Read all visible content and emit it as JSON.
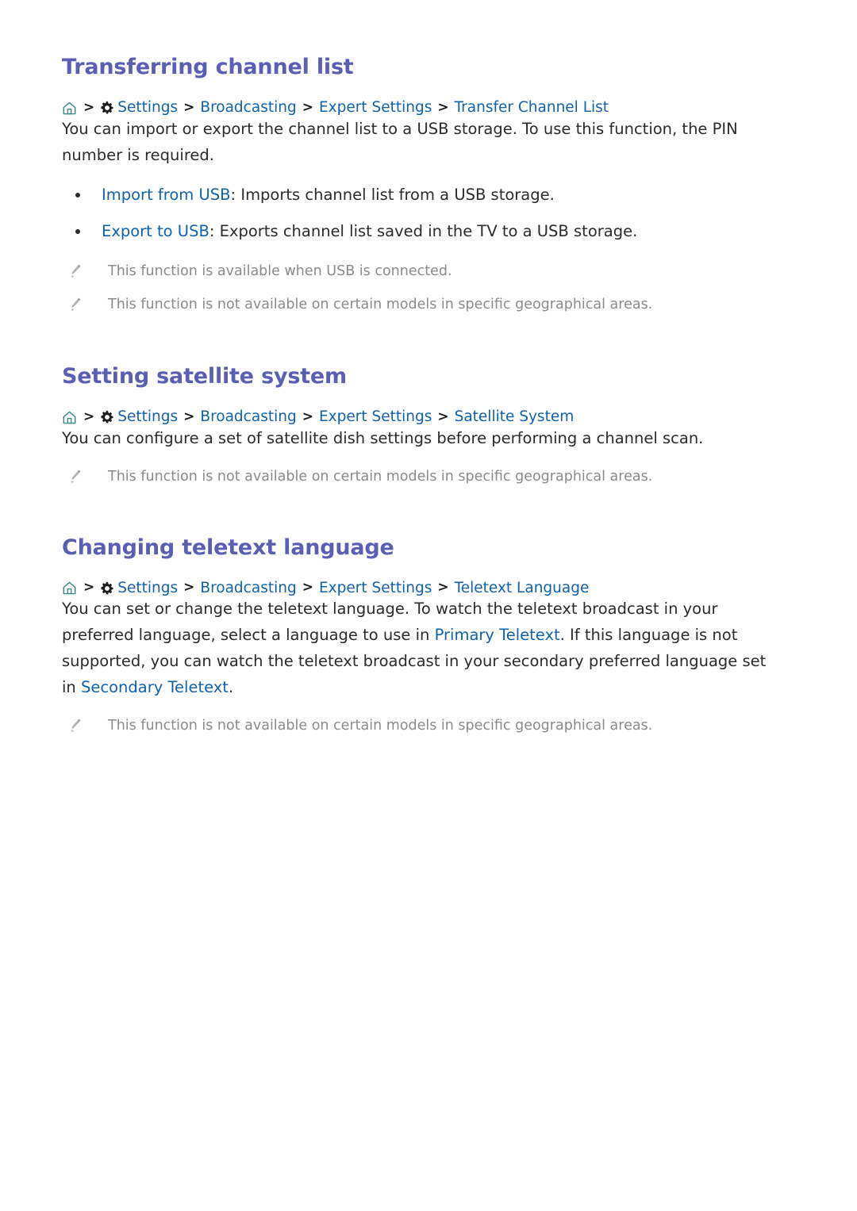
{
  "theme": {
    "background": "#ffffff",
    "heading_color": "#5a5fb3",
    "link_color": "#1162ad",
    "body_color": "#2b2b2b",
    "note_color": "#8b8b8b",
    "home_icon_color": "#3b8b8b",
    "gear_icon_color": "#1d1d1d",
    "separator_color": "#1d1d1d"
  },
  "icons": {
    "home": "home-icon",
    "gear": "gear-icon",
    "pencil": "pencil-icon",
    "separator": "chevron-right-icon"
  },
  "sections": [
    {
      "title": "Transferring channel list",
      "breadcrumb": {
        "home_icon": "home-icon",
        "gear_icon": "gear-icon",
        "items": [
          "Settings",
          "Broadcasting",
          "Expert Settings",
          "Transfer Channel List"
        ],
        "separator": ">"
      },
      "paragraph": "You can import or export the channel list to a USB storage. To use this function, the PIN number is required.",
      "bullets": [
        {
          "term": "Import from USB",
          "separator": ": ",
          "description": "Imports channel list from a USB storage."
        },
        {
          "term": "Export to USB",
          "separator": ": ",
          "description": "Exports channel list saved in the TV to a USB storage."
        }
      ],
      "notes": [
        "This function is available when USB is connected.",
        "This function is not available on certain models in specific geographical areas."
      ]
    },
    {
      "title": "Setting satellite system",
      "breadcrumb": {
        "home_icon": "home-icon",
        "gear_icon": "gear-icon",
        "items": [
          "Settings",
          "Broadcasting",
          "Expert Settings",
          "Satellite System"
        ],
        "separator": ">"
      },
      "paragraph": "You can configure a set of satellite dish settings before performing a channel scan.",
      "bullets": [],
      "notes": [
        "This function is not available on certain models in specific geographical areas."
      ]
    },
    {
      "title": "Changing teletext language",
      "breadcrumb": {
        "home_icon": "home-icon",
        "gear_icon": "gear-icon",
        "items": [
          "Settings",
          "Broadcasting",
          "Expert Settings",
          "Teletext Language"
        ],
        "separator": ">"
      },
      "paragraph_parts": {
        "t1": "You can set or change the teletext language. To watch the teletext broadcast in your preferred language, select a language to use in ",
        "link1": "Primary Teletext",
        "t2": ". If this language is not supported, you can watch the teletext broadcast in your secondary preferred language set in ",
        "link2": "Secondary Teletext",
        "t3": "."
      },
      "bullets": [],
      "notes": [
        "This function is not available on certain models in specific geographical areas."
      ]
    }
  ]
}
